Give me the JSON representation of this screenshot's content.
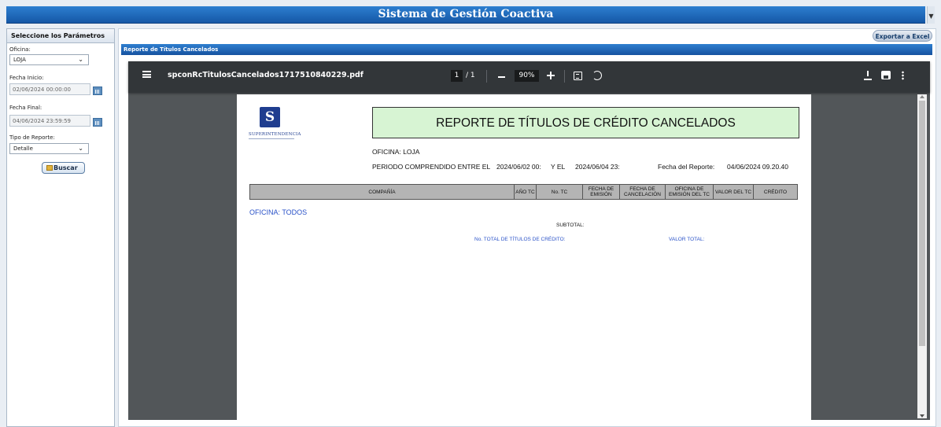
{
  "app": {
    "title": "Sistema de Gestión Coactiva"
  },
  "left_panel": {
    "header": "Seleccione los Parámetros",
    "oficina_label": "Oficina:",
    "oficina_value": "LOJA",
    "fecha_inicio_label": "Fecha Inicio:",
    "fecha_inicio_value": "02/06/2024 00:00:00",
    "fecha_final_label": "Fecha Final:",
    "fecha_final_value": "04/06/2024 23:59:59",
    "tipo_label": "Tipo de Reporte:",
    "tipo_value": "Detalle",
    "buscar_label": "Buscar"
  },
  "main": {
    "export_label": "Exportar a Excel",
    "report_header": "Reporte de Títulos Cancelados"
  },
  "pdf": {
    "filename": "spconRcTitulosCancelados1717510840229.pdf",
    "page_current": "1",
    "page_total": "/ 1",
    "zoom": "90%"
  },
  "report": {
    "logo_name": "Superintendencia",
    "title": "REPORTE DE TÍTULOS DE CRÉDITO CANCELADOS",
    "oficina_line": "OFICINA:   LOJA",
    "periodo_label": "PERIODO COMPRENDIDO ENTRE EL",
    "periodo_start": "2024/06/02 00:",
    "y_el": "Y EL",
    "periodo_end": "2024/06/04 23:",
    "fecha_reporte_label": "Fecha del Reporte:",
    "fecha_reporte_value": "04/06/2024 09.20.40",
    "columns": [
      "COMPAÑÍA",
      "AÑO TC",
      "No. TC",
      "FECHA DE EMISIÓN",
      "FECHA DE CANCELACIÓN",
      "OFICINA DE EMISIÓN DEL TC",
      "VALOR DEL TC",
      "CRÉDITO"
    ],
    "oficina_group": "OFICINA:   TODOS",
    "subtotal": "SUBTOTAL:",
    "total_titulos": "No. TOTAL DE TÍTULOS DE CRÉDITO:",
    "valor_total": "VALOR TOTAL:"
  }
}
